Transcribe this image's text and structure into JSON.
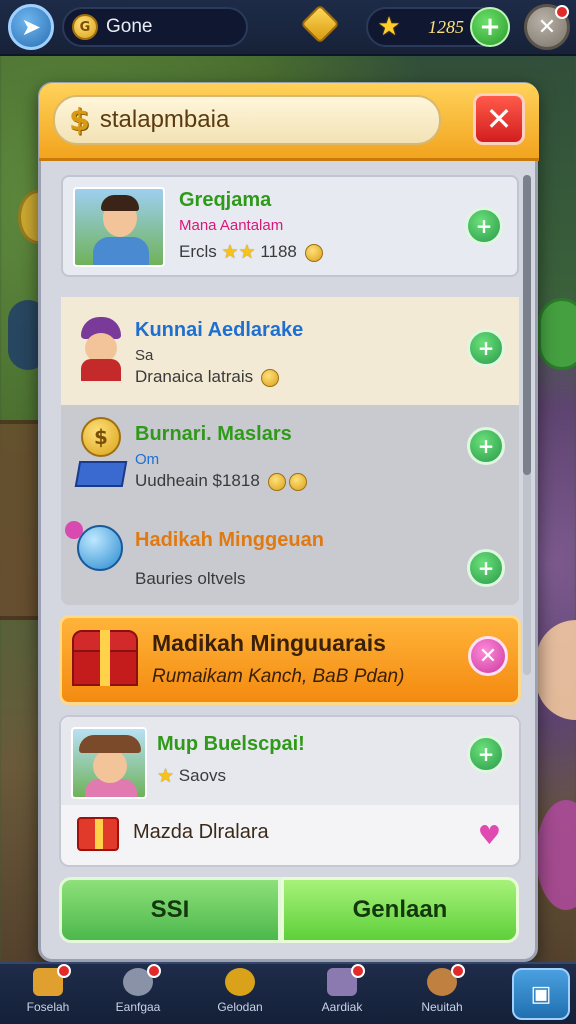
{
  "topbar": {
    "back_icon": "back-arrow-icon",
    "currency_label": "Gone",
    "star_count": "1285",
    "plus_symbol": "+",
    "close_symbol": "✕"
  },
  "panel": {
    "title": "stalapmbaia",
    "currency_symbol": "$",
    "close_symbol": "✕"
  },
  "rows": [
    {
      "name": "Greqjama",
      "subtitle": "Mana Aantalam",
      "detail_prefix": "Ercls",
      "detail_value": "1188",
      "action": "+"
    },
    {
      "name": "Kunnai Aedlarake",
      "subtitle": "Sa",
      "detail_prefix": "Dranaica latrais",
      "detail_value": "",
      "action": "+"
    },
    {
      "name": "Burnari. Maslars",
      "subtitle": "Om",
      "detail_prefix": "Uudheain",
      "detail_value": "$1818",
      "action": "+"
    },
    {
      "name": "Hadikah Minggeuan",
      "subtitle": "",
      "detail_prefix": "Bauries oltvels",
      "detail_value": "",
      "action": "+"
    }
  ],
  "featured": {
    "title": "Madikah Minguuarais",
    "subtitle": "Rumaikam Kanch, BaB Pdan)",
    "close_symbol": "✕"
  },
  "bottom_card": {
    "title": "Mup Buelscpai!",
    "subtitle": "Saovs",
    "action": "+",
    "reward_label": "Mazda Dlralara",
    "heart": "♥"
  },
  "buttons": {
    "left": "SSI",
    "right": "Genlaan"
  },
  "bottom_nav": [
    {
      "label": "Foselah"
    },
    {
      "label": "Eanfgaa"
    },
    {
      "label": "Gelodan"
    },
    {
      "label": "Aardiak"
    },
    {
      "label": "Neuitah"
    }
  ],
  "colors": {
    "accent_orange": "#f2a41e",
    "accent_green": "#4cb84c",
    "title_green": "#2f9a1a",
    "title_blue": "#1f6fd0",
    "title_pink": "#d8187a",
    "title_orange": "#e07a10"
  }
}
